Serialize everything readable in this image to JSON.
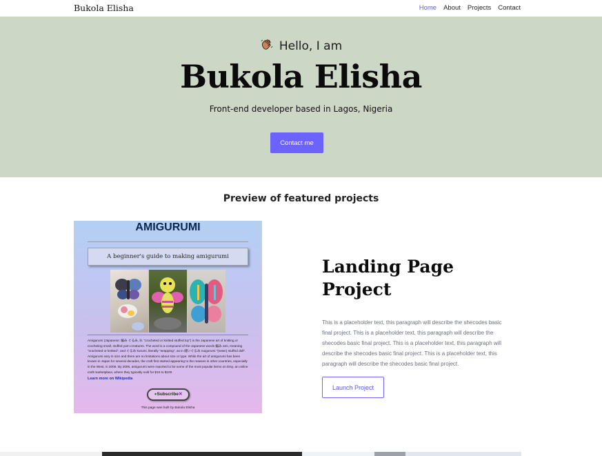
{
  "navbar": {
    "brand": "Bukola Elisha",
    "links": [
      {
        "label": "Home",
        "active": true
      },
      {
        "label": "About",
        "active": false
      },
      {
        "label": "Projects",
        "active": false
      },
      {
        "label": "Contact",
        "active": false
      }
    ]
  },
  "hero": {
    "greeting": "Hello, I am",
    "greeting_icon": "waving-hand-icon",
    "name": "Bukola Elisha",
    "subtitle": "Front-end developer based in Lagos, Nigeria",
    "contact_button": "Contact me",
    "background_color": "#cdd7c6",
    "accent_color": "#6c63ff"
  },
  "featured": {
    "title": "Preview of featured projects",
    "preview": {
      "heading": "AMIGURUMI",
      "box_text": "A beginner's guide to making amigurumi",
      "body": "Amigurumi (Japanese: 編み ぐるみ, lit. \"crocheted or knitted stuffed toy\") is the Japanese art of knitting or crocheting small, stuffed yarn creatures. The word is a compound of the Japanese words 編み ami, meaning \"crocheted or knitted\", and ぐるみ kurumi, literally \"wrapping\", as in 縫いぐるみ nuigurumi \"(sewn) stuffed doll\". Amigurumi vary in size and there are no limitations about size or type. While the art of amigurumi has been known in Japan for several decades, the craft first started appearing to the masses in other countries, especially in the West, in 2006. By 2006, amigurumi were reported to be some of the most popular items on Etsy, an online craft marketplace, where they typically sold for $10 to $100.",
      "link": "Learn more on Wikipedia",
      "subscribe": "Subscribe",
      "footer": "This page was built by Bukola Elisha"
    },
    "project_title": "Landing Page Project",
    "project_description": "This is a placeholder text, this paragraph will describe the shecodes basic final project. This is a placeholder text, this paragraph will describe the shecodes basic final project. This is a placeholder text, this paragraph will describe the shecodes basic final project. This is a placeholder text, this paragraph will describe the shecodes basic final project.",
    "launch_button": "Launch Project"
  }
}
